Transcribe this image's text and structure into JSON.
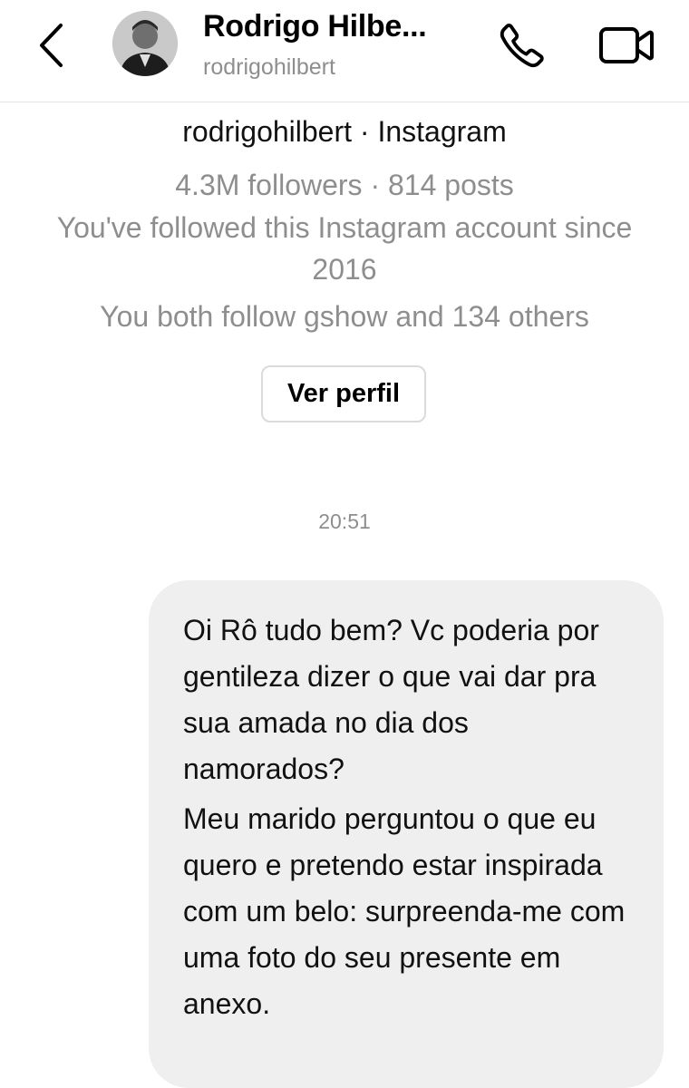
{
  "header": {
    "name": "Rodrigo Hilbe...",
    "username": "rodrigohilbert",
    "back_icon": "chevron-left-icon",
    "call_icon": "phone-icon",
    "video_icon": "video-camera-icon"
  },
  "profile": {
    "line1": "rodrigohilbert · Instagram",
    "stats": "4.3M followers · 814 posts",
    "followed_since": "You've followed this Instagram account since 2016",
    "mutual": "You both follow gshow and 134 others",
    "view_button": "Ver perfil"
  },
  "thread": {
    "timestamp": "20:51",
    "message": {
      "paragraph1": "Oi Rô tudo bem? Vc poderia por gentileza dizer o que vai dar pra sua amada no dia dos namorados?",
      "paragraph2": "Meu marido perguntou o que eu quero e pretendo estar inspirada com um belo: surpreenda-me com uma foto do seu presente em anexo."
    }
  },
  "colors": {
    "secondary_text": "#8e8e8e",
    "bubble_bg": "#efefef",
    "divider": "#e3e3e3"
  }
}
